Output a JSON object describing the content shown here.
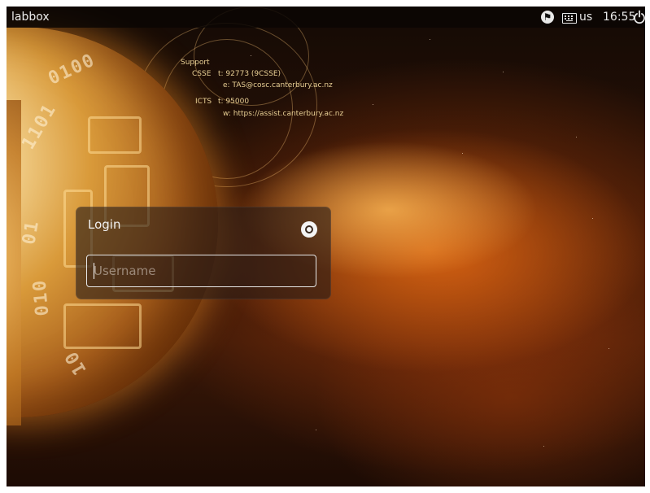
{
  "top_panel": {
    "hostname": "labbox",
    "keyboard_layout": "us",
    "clock": "16:55",
    "icons": [
      "accessibility-icon",
      "keyboard-icon",
      "power-icon"
    ]
  },
  "support": {
    "heading": "Support",
    "csse_label": "CSSE",
    "csse_phone": "t: 92773 (9CSSE)",
    "csse_email": "e: TAS@cosc.canterbury.ac.nz",
    "icts_label": "ICTS",
    "icts_phone": "t: 95000",
    "icts_web": "w: https://assist.canterbury.ac.nz"
  },
  "wallpaper_binary": [
    "0100",
    "1101",
    "01",
    "010",
    "10"
  ],
  "login": {
    "title": "Login",
    "username_placeholder": "Username",
    "username_value": ""
  },
  "colors": {
    "panel_bg": "#0a0604",
    "login_box_bg": "#281c16",
    "support_text": "#e8cf94",
    "accent_orange": "#e06e14"
  }
}
